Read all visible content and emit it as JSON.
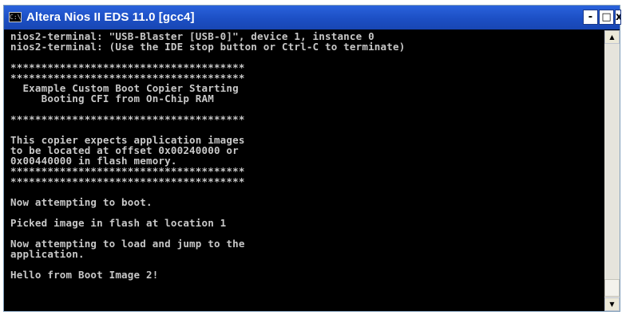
{
  "window": {
    "title": "Altera Nios II EDS 11.0 [gcc4]",
    "controls": {
      "minimize": "-",
      "maximize": "□",
      "close": "x"
    }
  },
  "console": {
    "lines": [
      "nios2-terminal: \"USB-Blaster [USB-0]\", device 1, instance 0",
      "nios2-terminal: (Use the IDE stop button or Ctrl-C to terminate)",
      "",
      "**************************************",
      "**************************************",
      "  Example Custom Boot Copier Starting",
      "     Booting CFI from On-Chip RAM",
      "",
      "**************************************",
      "",
      "This copier expects application images",
      "to be located at offset 0x00240000 or",
      "0x00440000 in flash memory.",
      "**************************************",
      "**************************************",
      "",
      "Now attempting to boot.",
      "",
      "Picked image in flash at location 1",
      "",
      "Now attempting to load and jump to the",
      "application.",
      "",
      "Hello from Boot Image 2!"
    ]
  },
  "scrollbar": {
    "up_arrow": "▲",
    "down_arrow": "▼"
  },
  "colors": {
    "titlebar": "#1c4fc4",
    "console_bg": "#000000",
    "console_text": "#c8c8c8"
  }
}
